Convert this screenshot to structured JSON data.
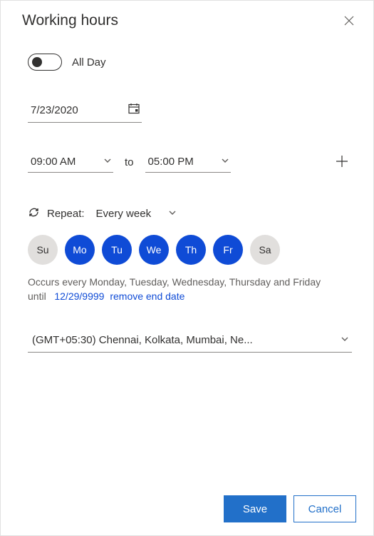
{
  "header": {
    "title": "Working hours"
  },
  "allDay": {
    "label": "All Day",
    "enabled": false
  },
  "date": {
    "value": "7/23/2020"
  },
  "time": {
    "start": "09:00 AM",
    "end": "05:00 PM",
    "to": "to"
  },
  "repeat": {
    "label": "Repeat:",
    "value": "Every week",
    "days": [
      {
        "abbr": "Su",
        "selected": false
      },
      {
        "abbr": "Mo",
        "selected": true
      },
      {
        "abbr": "Tu",
        "selected": true
      },
      {
        "abbr": "We",
        "selected": true
      },
      {
        "abbr": "Th",
        "selected": true
      },
      {
        "abbr": "Fr",
        "selected": true
      },
      {
        "abbr": "Sa",
        "selected": false
      }
    ],
    "summary": "Occurs every Monday, Tuesday, Wednesday, Thursday and Friday",
    "until_label": "until",
    "until_date": "12/29/9999",
    "remove_label": "remove end date"
  },
  "timezone": {
    "value": "(GMT+05:30) Chennai, Kolkata, Mumbai, Ne..."
  },
  "footer": {
    "save": "Save",
    "cancel": "Cancel"
  }
}
